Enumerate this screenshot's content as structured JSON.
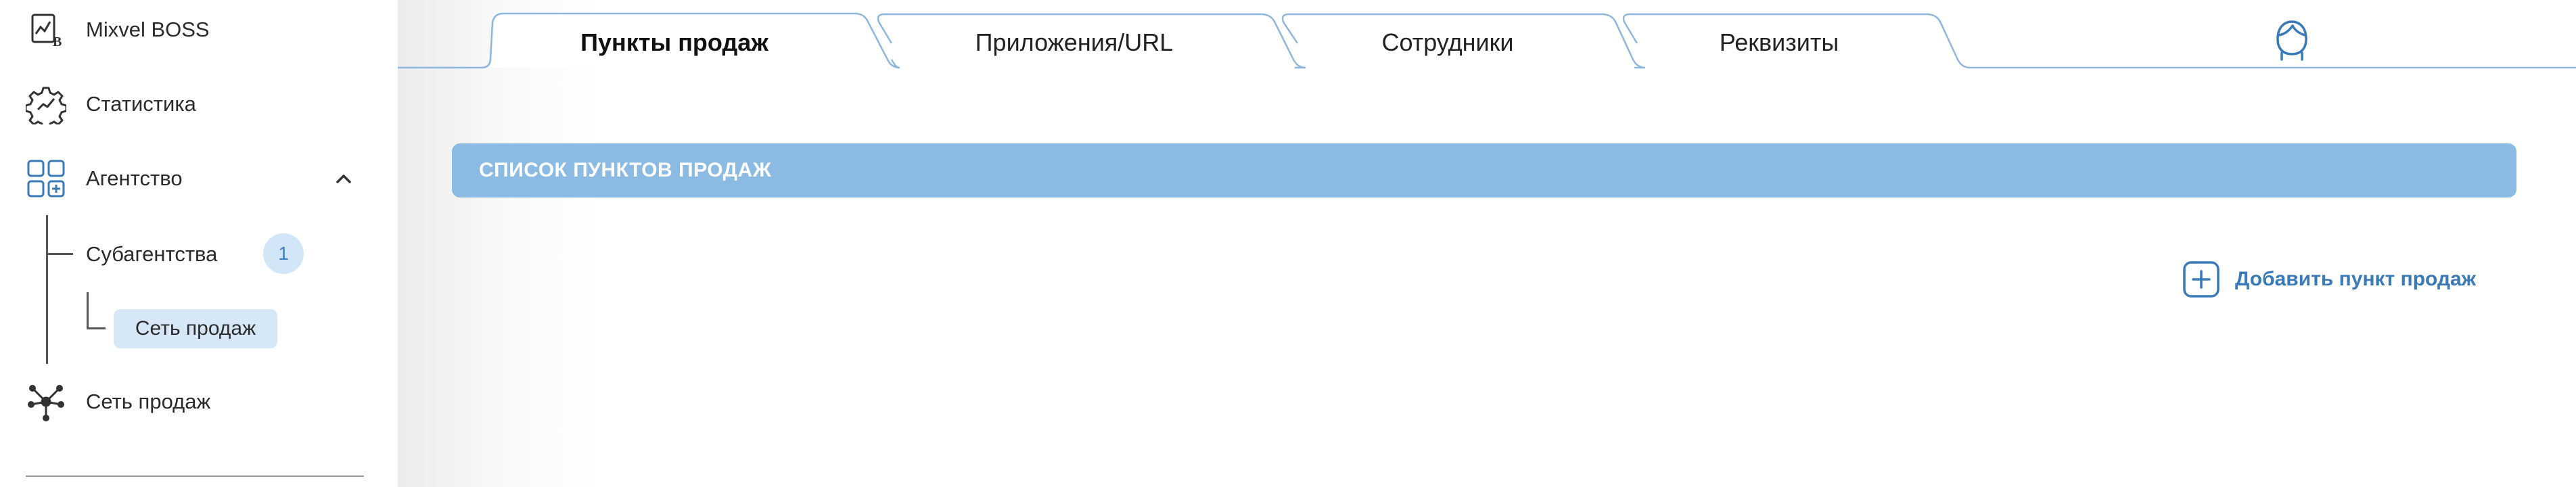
{
  "sidebar": {
    "items": [
      {
        "label": "Mixvel BOSS",
        "icon": "chart-document-icon"
      },
      {
        "label": "Статистика",
        "icon": "gear-chart-icon"
      },
      {
        "label": "Агентство",
        "icon": "grid-add-icon"
      },
      {
        "label": "Сеть продаж",
        "icon": "network-icon"
      }
    ],
    "sub_items": [
      {
        "label": "Субагентства",
        "badge": "1"
      },
      {
        "label": "Сеть продаж",
        "active": true
      }
    ]
  },
  "tabs": [
    {
      "label": "Пункты продаж",
      "active": true
    },
    {
      "label": "Приложения/URL",
      "active": false
    },
    {
      "label": "Сотрудники",
      "active": false
    },
    {
      "label": "Реквизиты",
      "active": false
    }
  ],
  "main": {
    "section_title": "СПИСОК ПУНКТОВ ПРОДАЖ",
    "add_button_label": "Добавить пункт продаж"
  },
  "colors": {
    "accent": "#3a7ab8",
    "header_bg": "#8bbbe3",
    "active_pill": "#d6e8f7",
    "badge_bg": "#d2e6f8",
    "tab_border": "#8fb6db"
  },
  "icons": {
    "user": "user-avatar-icon",
    "add": "plus-square-icon",
    "collapse": "chevron-up-icon"
  }
}
